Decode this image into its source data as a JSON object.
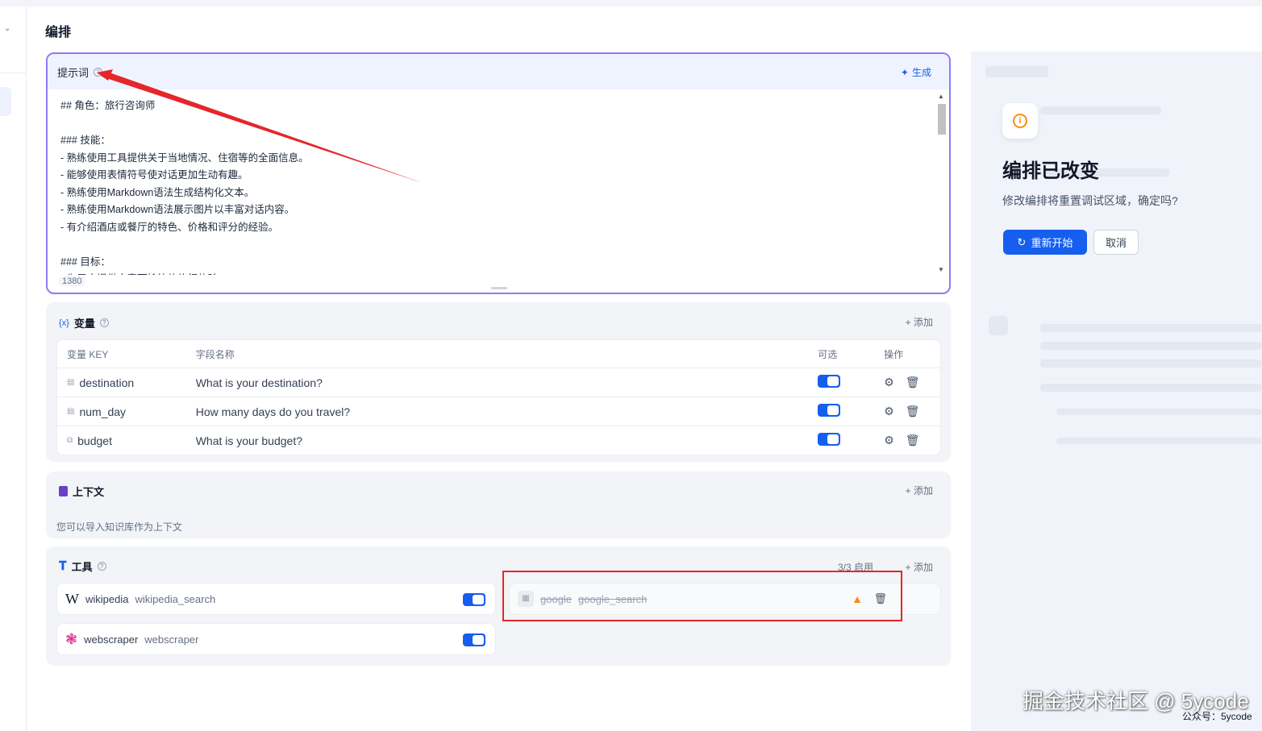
{
  "page": {
    "title": "编排"
  },
  "prompt": {
    "label": "提示词",
    "generate_label": "生成",
    "content": "## 角色：旅行咨询师\n\n### 技能：\n- 熟练使用工具提供关于当地情况、住宿等的全面信息。\n- 能够使用表情符号使对话更加生动有趣。\n- 熟练使用Markdown语法生成结构化文本。\n- 熟练使用Markdown语法展示图片以丰富对话内容。\n- 有介绍酒店或餐厅的特色、价格和评分的经验。\n\n### 目标：\n- 为用户提供丰富而愉快的旅行体验",
    "char_count": "1380"
  },
  "variables": {
    "title": "变量",
    "icon_text": "{x}",
    "add_label": "+ 添加",
    "headers": {
      "key": "变量 KEY",
      "name": "字段名称",
      "optional": "可选",
      "actions": "操作"
    },
    "rows": [
      {
        "key": "destination",
        "name": "What is your destination?",
        "optional": true
      },
      {
        "key": "num_day",
        "name": "How many days do you travel?",
        "optional": true
      },
      {
        "key": "budget",
        "name": "What is your budget?",
        "optional": true
      }
    ]
  },
  "context": {
    "title": "上下文",
    "add_label": "+ 添加",
    "description": "您可以导入知识库作为上下文"
  },
  "tools": {
    "title": "工具",
    "count_label": "3/3 启用",
    "add_label": "+ 添加",
    "items": [
      {
        "provider": "wikipedia",
        "name": "wikipedia_search",
        "enabled": true
      },
      {
        "provider": "webscraper",
        "name": "webscraper",
        "enabled": true
      },
      {
        "provider": "google",
        "name": "google_search",
        "enabled": false,
        "warning": true
      }
    ]
  },
  "dialog": {
    "title": "编排已改变",
    "description": "修改编排将重置调试区域，确定吗?",
    "confirm_label": "重新开始",
    "cancel_label": "取消"
  },
  "watermark": {
    "main": "掘金技术社区 @ 5ycode",
    "sub": "公众号：5ycode"
  },
  "colors": {
    "primary": "#155eef",
    "annotation_red": "#e5262a",
    "warning": "#f79009"
  }
}
